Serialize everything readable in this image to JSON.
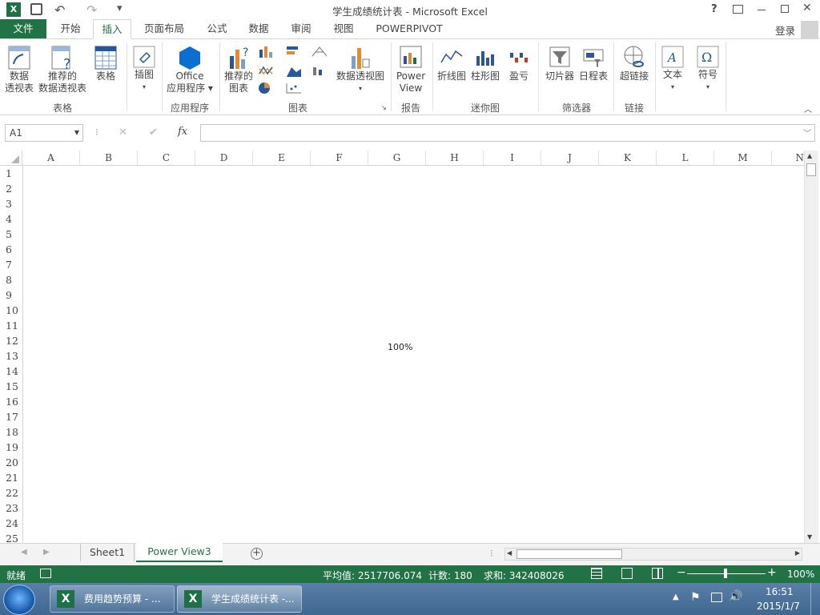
{
  "window": {
    "title": "学生成绩统计表 - Microsoft Excel",
    "help": "?",
    "login": "登录"
  },
  "qat": {
    "undo": "↶",
    "redo": "↷",
    "more": "▾"
  },
  "tabs": [
    "文件",
    "开始",
    "插入",
    "页面布局",
    "公式",
    "数据",
    "审阅",
    "视图",
    "POWERPIVOT"
  ],
  "ribbon": {
    "pivot": "数据\n透视表",
    "recpivot": "推荐的\n数据透视表",
    "table": "表格",
    "group_table": "表格",
    "illus": "插图",
    "office": "Office\n应用程序 ▾",
    "group_apps": "应用程序",
    "reccharts": "推荐的\n图表",
    "pivotchart": "数据透视图",
    "group_charts": "图表",
    "powerview": "Power\nView",
    "group_report": "报告",
    "line": "折线图",
    "column": "柱形图",
    "winloss": "盈亏",
    "group_spark": "迷你图",
    "slicer": "切片器",
    "timeline": "日程表",
    "group_filter": "筛选器",
    "hyperlink": "超链接",
    "group_links": "链接",
    "text": "文本",
    "symbol": "符号"
  },
  "formula_bar": {
    "namebox": "A1",
    "fx": "fx",
    "cancel": "✕",
    "enter": "✔",
    "value": ""
  },
  "columns": [
    "A",
    "B",
    "C",
    "D",
    "E",
    "F",
    "G",
    "H",
    "I",
    "J",
    "K",
    "L",
    "M",
    "N"
  ],
  "rows": [
    "1",
    "2",
    "3",
    "4",
    "5",
    "6",
    "7",
    "8",
    "9",
    "10",
    "11",
    "12",
    "13",
    "14",
    "15",
    "16",
    "17",
    "18",
    "19",
    "20",
    "21",
    "22",
    "23",
    "24",
    "25"
  ],
  "canvas_zoom": "100%",
  "sheets": [
    "Sheet1",
    "Power View3"
  ],
  "status": {
    "ready": "就绪",
    "average": "平均值: 2517706.074",
    "count": "计数: 180",
    "sum": "求和: 342408026",
    "zoom": "100%"
  },
  "taskbar": {
    "task1": "费用趋势预算 - ...",
    "task2": "学生成绩统计表 -...",
    "time": "16:51",
    "date": "2015/1/7"
  }
}
